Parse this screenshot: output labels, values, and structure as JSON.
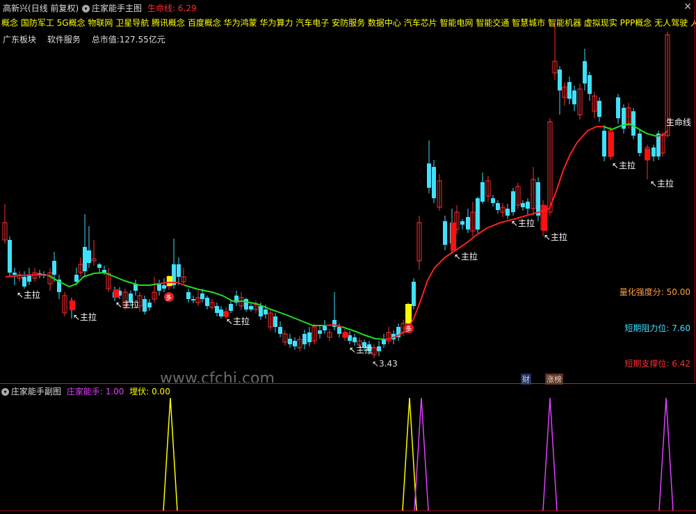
{
  "header": {
    "stock_name": "高新兴",
    "period": "(日线 前复权)",
    "indicator": "庄家能手主图",
    "life_line_label": "生命线:",
    "life_line_value": "6.29",
    "close_icon": "close-icon"
  },
  "concepts": "概念 国防军工 5G概念 物联网 卫星导航 腾讯概念 百度概念 华为鸿蒙 华为算力 汽车电子 安防服务 数据中心 汽车芯片 智能电网 智能交通 智慧城市 智能机器 虚拟现实 PPP概念 无人驾驶 人工",
  "board": {
    "region": "广东板块",
    "industry": "软件服务",
    "market_cap": "总市值:127.55亿元"
  },
  "chart_data": {
    "type": "candlestick",
    "annotations": {
      "main_pull": "主拉",
      "low_price": "3.43",
      "life_line_end_label": "生命线",
      "buy_marker": "多"
    },
    "metrics": [
      {
        "label": "量化强度分:",
        "value": "50.00",
        "color": "#ffa040"
      },
      {
        "label": "短期阻力位:",
        "value": "7.60",
        "color": "#40e0ff"
      },
      {
        "label": "短期支撑位:",
        "value": "6.42",
        "color": "#ff3030"
      }
    ],
    "badges": {
      "finance": "财",
      "limit_up": "涨榜"
    },
    "watermark": "www.cfchi.com"
  },
  "sub": {
    "title": "庄家能手副图",
    "zjns_label": "庄家能手: 1.00",
    "mf_label": "埋伏: 0.00"
  },
  "colors": {
    "up": "#ff3030",
    "down": "#40e0ff",
    "lifeline_up": "#ff2020",
    "lifeline_down": "#20e020",
    "yellow": "#ffff00",
    "magenta": "#e040ff"
  }
}
